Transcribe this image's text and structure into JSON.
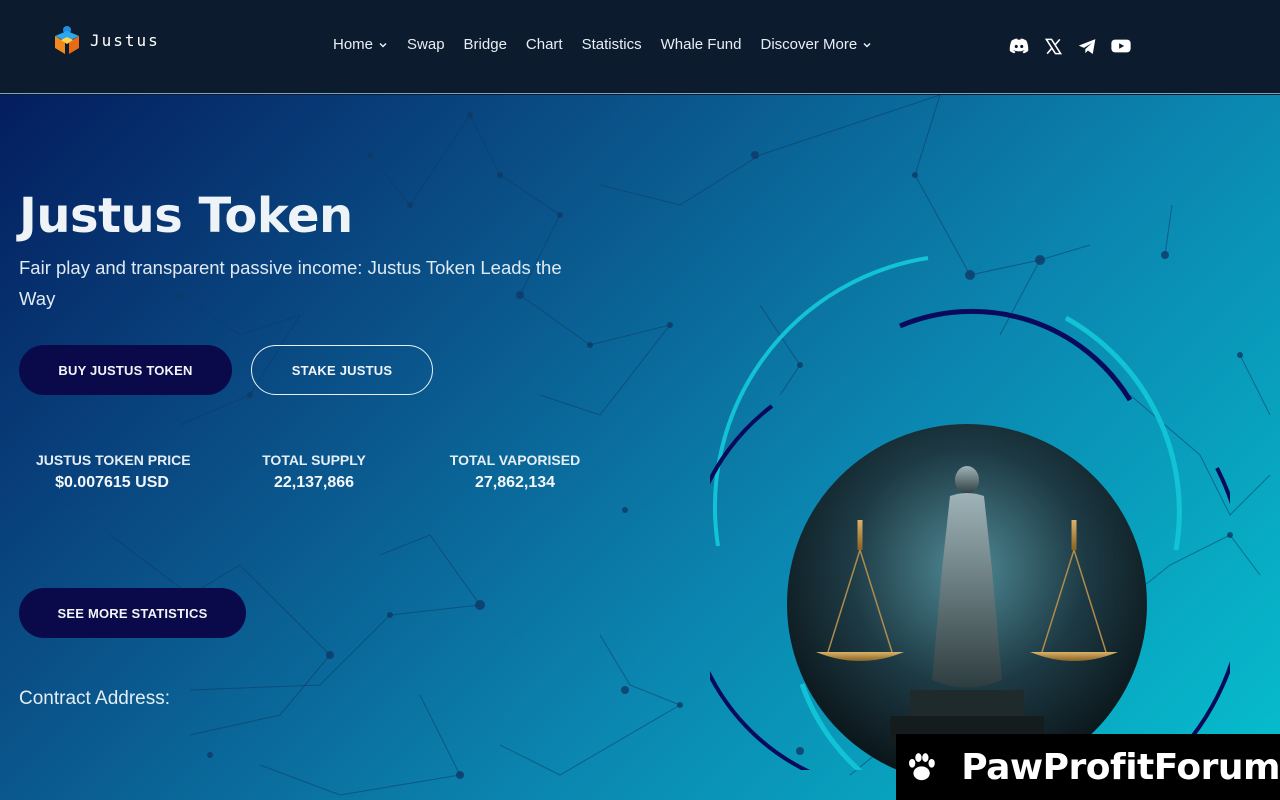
{
  "brand": {
    "name": "Justus"
  },
  "nav": {
    "items": [
      {
        "label": "Home",
        "has_dropdown": true
      },
      {
        "label": "Swap",
        "has_dropdown": false
      },
      {
        "label": "Bridge",
        "has_dropdown": false
      },
      {
        "label": "Chart",
        "has_dropdown": false
      },
      {
        "label": "Statistics",
        "has_dropdown": false
      },
      {
        "label": "Whale Fund",
        "has_dropdown": false
      },
      {
        "label": "Discover More",
        "has_dropdown": true
      }
    ]
  },
  "socials": [
    "discord-icon",
    "x-twitter-icon",
    "telegram-icon",
    "youtube-icon"
  ],
  "hero": {
    "title": "Justus Token",
    "subtitle": "Fair play and transparent passive income: Justus Token Leads the Way",
    "buy_label": "BUY JUSTUS TOKEN",
    "stake_label": "STAKE JUSTUS",
    "more_stats_label": "SEE MORE STATISTICS",
    "contract_label": "Contract Address:"
  },
  "stats": [
    {
      "label": "JUSTUS TOKEN PRICE",
      "value": "$0.007615 USD"
    },
    {
      "label": "TOTAL SUPPLY",
      "value": "22,137,866"
    },
    {
      "label": "TOTAL VAPORISED",
      "value": "27,862,134"
    }
  ],
  "watermark": {
    "text": "PawProfitForum"
  },
  "colors": {
    "header_bg": "#0c1b2e",
    "button_dark": "#0a0a4a",
    "ring_cyan": "#12c3d6",
    "ring_navy": "#0a0a5a",
    "gradient_start": "#041d5e",
    "gradient_end": "#06c0cf"
  }
}
